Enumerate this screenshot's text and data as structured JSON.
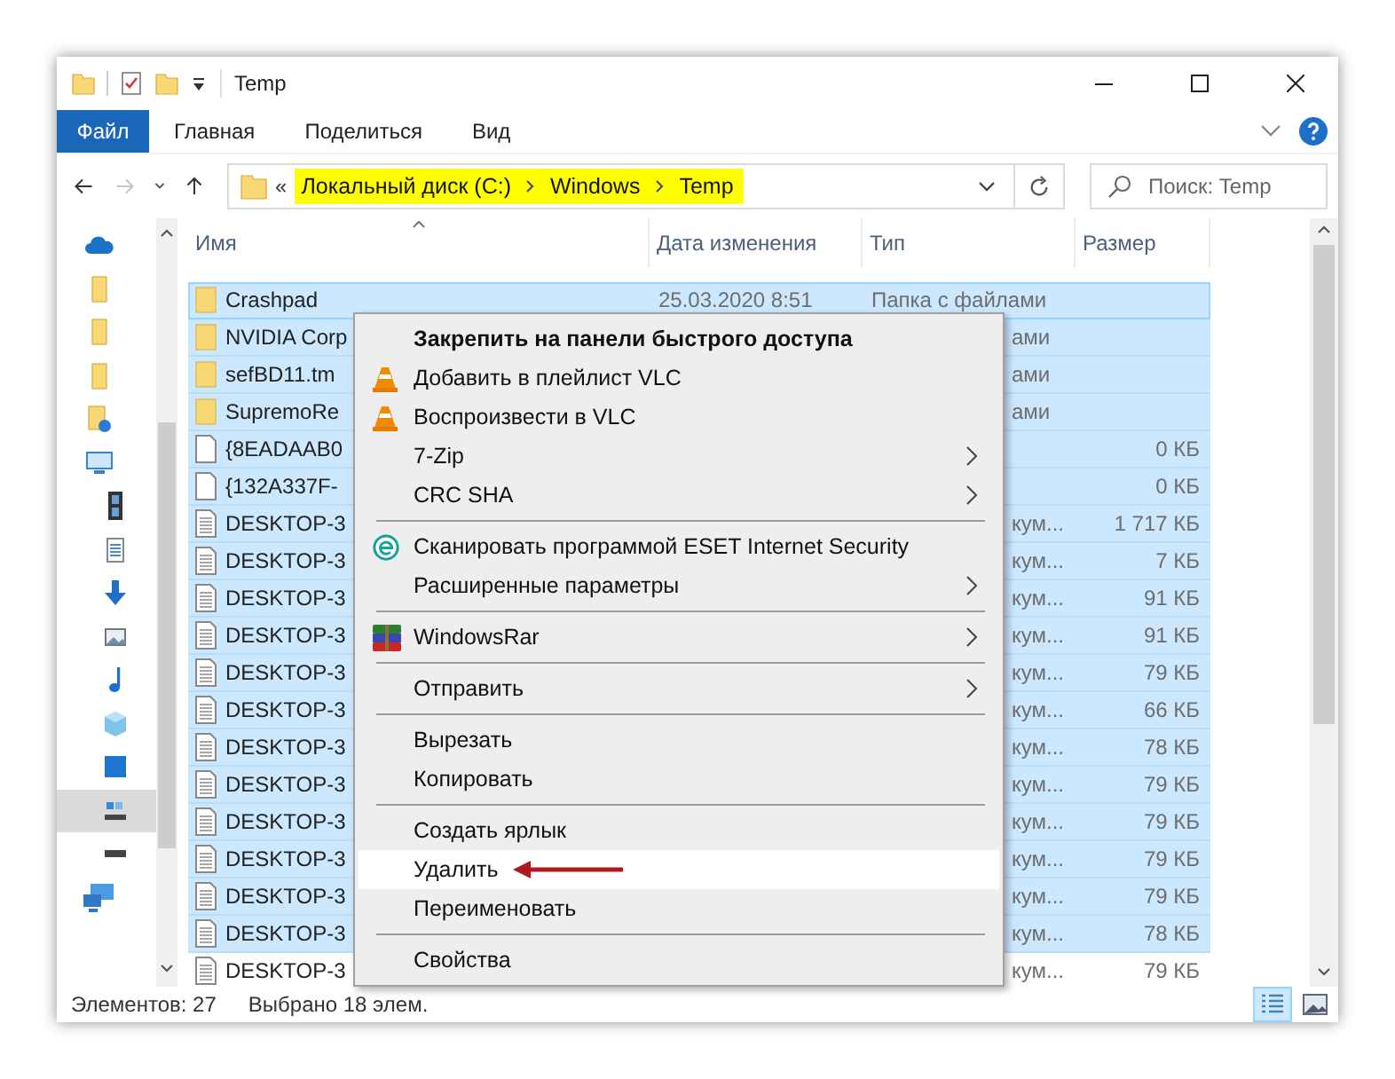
{
  "window": {
    "title": "Temp"
  },
  "ribbon": {
    "tabs": [
      {
        "label": "Файл",
        "kind": "file"
      },
      {
        "label": "Главная",
        "kind": "tab"
      },
      {
        "label": "Поделиться",
        "kind": "tab"
      },
      {
        "label": "Вид",
        "kind": "tab"
      }
    ]
  },
  "navigation": {
    "forward_disabled": true
  },
  "address_bar": {
    "overflow": "«",
    "highlighted": true,
    "crumbs": [
      "Локальный диск (C:)",
      "Windows",
      "Temp"
    ]
  },
  "search": {
    "placeholder": "Поиск: Temp"
  },
  "sidebar": {
    "items": [
      {
        "kind": "cloud",
        "selected": false
      },
      {
        "kind": "folder",
        "selected": false
      },
      {
        "kind": "folder",
        "selected": false
      },
      {
        "kind": "folder",
        "selected": false
      },
      {
        "kind": "shared",
        "selected": false
      },
      {
        "kind": "pc",
        "selected": false
      },
      {
        "kind": "video",
        "selected": false
      },
      {
        "kind": "docs",
        "selected": false
      },
      {
        "kind": "downloads",
        "selected": false
      },
      {
        "kind": "pictures",
        "selected": false
      },
      {
        "kind": "music",
        "selected": false
      },
      {
        "kind": "objects",
        "selected": false
      },
      {
        "kind": "desktop",
        "selected": false
      },
      {
        "kind": "drive",
        "selected": true
      },
      {
        "kind": "drive2",
        "selected": false
      },
      {
        "kind": "network",
        "selected": false
      }
    ]
  },
  "table": {
    "columns": [
      {
        "label": "Имя",
        "sorted": true
      },
      {
        "label": "Дата изменения",
        "sorted": false
      },
      {
        "label": "Тип",
        "sorted": false
      },
      {
        "label": "Размер",
        "sorted": false
      }
    ],
    "rows": [
      {
        "kind": "folder",
        "name": "Crashpad",
        "date": "25.03.2020 8:51",
        "type": "Папка с файлами",
        "selected": true
      },
      {
        "kind": "folder",
        "name": "NVIDIA Corp",
        "type": "ами",
        "selected": true
      },
      {
        "kind": "folder",
        "name": "sefBD11.tm",
        "type": "ами",
        "selected": true
      },
      {
        "kind": "folder",
        "name": "SupremoRe",
        "type": "ами",
        "selected": true
      },
      {
        "kind": "file",
        "name": "{8EADAAB0",
        "size": "0 КБ",
        "selected": true
      },
      {
        "kind": "file",
        "name": "{132A337F-",
        "size": "0 КБ",
        "selected": true
      },
      {
        "kind": "text",
        "name": "DESKTOP-3",
        "type": "кум...",
        "size": "1 717 КБ",
        "selected": true
      },
      {
        "kind": "text",
        "name": "DESKTOP-3",
        "type": "кум...",
        "size": "7 КБ",
        "selected": true
      },
      {
        "kind": "text",
        "name": "DESKTOP-3",
        "type": "кум...",
        "size": "91 КБ",
        "selected": true
      },
      {
        "kind": "text",
        "name": "DESKTOP-3",
        "type": "кум...",
        "size": "91 КБ",
        "selected": true
      },
      {
        "kind": "text",
        "name": "DESKTOP-3",
        "type": "кум...",
        "size": "79 КБ",
        "selected": true
      },
      {
        "kind": "text",
        "name": "DESKTOP-3",
        "type": "кум...",
        "size": "66 КБ",
        "selected": true
      },
      {
        "kind": "text",
        "name": "DESKTOP-3",
        "type": "кум...",
        "size": "78 КБ",
        "selected": true
      },
      {
        "kind": "text",
        "name": "DESKTOP-3",
        "type": "кум...",
        "size": "79 КБ",
        "selected": true
      },
      {
        "kind": "text",
        "name": "DESKTOP-3",
        "type": "кум...",
        "size": "79 КБ",
        "selected": true
      },
      {
        "kind": "text",
        "name": "DESKTOP-3",
        "type": "кум...",
        "size": "79 КБ",
        "selected": true
      },
      {
        "kind": "text",
        "name": "DESKTOP-3",
        "type": "кум...",
        "size": "79 КБ",
        "selected": true
      },
      {
        "kind": "text",
        "name": "DESKTOP-3",
        "type": "кум...",
        "size": "78 КБ",
        "selected": true
      },
      {
        "kind": "text",
        "name": "DESKTOP-3",
        "type": "кум...",
        "size": "79 КБ",
        "selected": false
      }
    ]
  },
  "context_menu": {
    "items": [
      {
        "kind": "command",
        "label": "Закрепить на панели быстрого доступа",
        "default": true,
        "submenu": false,
        "selected": false
      },
      {
        "kind": "command",
        "label": "Добавить в плейлист VLC",
        "default": false,
        "submenu": false,
        "selected": false
      },
      {
        "kind": "command",
        "label": "Воспроизвести в VLC",
        "default": false,
        "submenu": false,
        "selected": false
      },
      {
        "kind": "command",
        "label": "7-Zip",
        "default": false,
        "submenu": true,
        "selected": false
      },
      {
        "kind": "command",
        "label": "CRC SHA",
        "default": false,
        "submenu": true,
        "selected": false
      },
      {
        "kind": "separator"
      },
      {
        "kind": "command",
        "label": "Сканировать программой ESET Internet Security",
        "default": false,
        "submenu": false,
        "selected": false
      },
      {
        "kind": "command",
        "label": "Расширенные параметры",
        "default": false,
        "submenu": true,
        "selected": false
      },
      {
        "kind": "separator"
      },
      {
        "kind": "command",
        "label": "WindowsRar",
        "default": false,
        "submenu": true,
        "selected": false
      },
      {
        "kind": "separator"
      },
      {
        "kind": "command",
        "label": "Отправить",
        "default": false,
        "submenu": true,
        "selected": false
      },
      {
        "kind": "separator"
      },
      {
        "kind": "command",
        "label": "Вырезать",
        "default": false,
        "submenu": false,
        "selected": false
      },
      {
        "kind": "command",
        "label": "Копировать",
        "default": false,
        "submenu": false,
        "selected": false
      },
      {
        "kind": "separator"
      },
      {
        "kind": "command",
        "label": "Создать ярлык",
        "default": false,
        "submenu": false,
        "selected": false
      },
      {
        "kind": "command",
        "label": "Удалить",
        "default": false,
        "submenu": false,
        "selected": true
      },
      {
        "kind": "command",
        "label": "Переименовать",
        "default": false,
        "submenu": false,
        "selected": false
      },
      {
        "kind": "separator"
      },
      {
        "kind": "command",
        "label": "Свойства",
        "default": false,
        "submenu": false,
        "selected": false
      }
    ]
  },
  "status_bar": {
    "items_count": "Элементов: 27",
    "selection": "Выбрано 18 элем."
  },
  "view_buttons": [
    {
      "kind": "details",
      "selected": true
    },
    {
      "kind": "tiles",
      "selected": false
    }
  ]
}
